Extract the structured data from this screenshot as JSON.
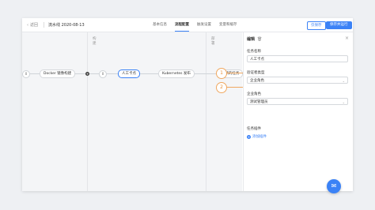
{
  "header": {
    "back_label": "返回",
    "pipeline_title": "流水线 2020-08-13",
    "tabs": [
      {
        "label": "基本信息"
      },
      {
        "label": "流程配置"
      },
      {
        "label": "触发设置"
      },
      {
        "label": "变量和缓存"
      }
    ],
    "save_label": "仅保存",
    "save_run_label": "保存并运行"
  },
  "canvas": {
    "stage_labels": [
      "构建",
      "部署"
    ],
    "nodes": {
      "start_count": "0",
      "docker_build": "Docker 镜像构建",
      "mid_count": "0",
      "manual_card": "人工卡点",
      "k8s_release": "Kubernetes 发布",
      "new_task": "新的任务"
    }
  },
  "callouts": [
    "1",
    "2"
  ],
  "panel": {
    "title": "编辑",
    "task_name_label": "任务名称",
    "task_name_value": "人工卡点",
    "validator_type_label": "验证者类型",
    "validator_type_value": "企业角色",
    "enterprise_role_label": "企业角色",
    "enterprise_role_value": "测试管理员",
    "plugins_label": "任务插件",
    "add_plugin_label": "添加插件"
  },
  "colors": {
    "accent": "#3b82f6",
    "callout": "#f0a860"
  }
}
